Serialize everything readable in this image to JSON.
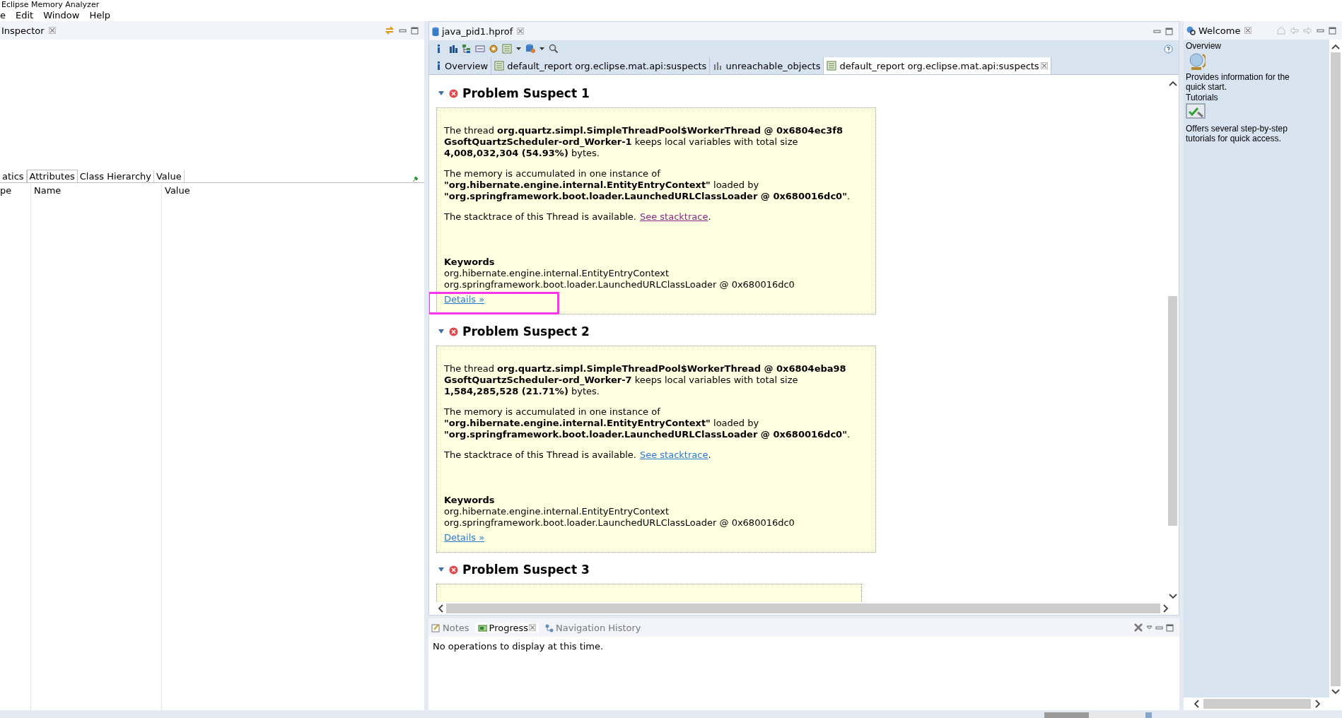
{
  "window": {
    "title": "Eclipse Memory Analyzer"
  },
  "menu": [
    {
      "label": "e"
    },
    {
      "label": "Edit"
    },
    {
      "label": "Window"
    },
    {
      "label": "Help"
    }
  ],
  "inspector": {
    "tab": "Inspector",
    "tabs": [
      {
        "label": "atics",
        "selected": false
      },
      {
        "label": "Attributes",
        "selected": true
      },
      {
        "label": "Class Hierarchy",
        "selected": false
      },
      {
        "label": "Value",
        "selected": false
      }
    ],
    "columns": [
      "pe",
      "Name",
      "Value"
    ]
  },
  "editor": {
    "tab": "java_pid1.hprof",
    "report_tabs": [
      {
        "label": "Overview",
        "kind": "info",
        "selected": false,
        "closable": false
      },
      {
        "label": "default_report  org.eclipse.mat.api:suspects",
        "kind": "report",
        "selected": false,
        "closable": false
      },
      {
        "label": "unreachable_objects",
        "kind": "chart",
        "selected": false,
        "closable": false
      },
      {
        "label": "default_report  org.eclipse.mat.api:suspects",
        "kind": "report",
        "selected": true,
        "closable": true
      }
    ],
    "suspects": [
      {
        "title": "Problem Suspect 1",
        "expanded": true,
        "paragraphs": [
          "The thread **org.quartz.simpl.SimpleThreadPool$WorkerThread @ 0x6804ec3f8 GsoftQuartzScheduler-ord_Worker-1** keeps local variables with total size **4,008,032,304 (54.93%)** bytes.",
          "The memory is accumulated in one instance of **\"org.hibernate.engine.internal.EntityEntryContext\"** loaded by **\"org.springframework.boot.loader.LaunchedURLClassLoader @ 0x680016dc0\"**."
        ],
        "stack_text": "The stacktrace of this Thread is available.",
        "stack_link": {
          "label": "See stacktrace",
          "visited": true
        },
        "stack_end": ".",
        "keywords_title": "Keywords",
        "keywords": [
          "org.hibernate.engine.internal.EntityEntryContext",
          "org.springframework.boot.loader.LaunchedURLClassLoader @ 0x680016dc0"
        ],
        "details": "Details »",
        "highlighted": true
      },
      {
        "title": "Problem Suspect 2",
        "expanded": true,
        "paragraphs": [
          "The thread **org.quartz.simpl.SimpleThreadPool$WorkerThread @ 0x6804eba98 GsoftQuartzScheduler-ord_Worker-7** keeps local variables with total size **1,584,285,528 (21.71%)** bytes.",
          "The memory is accumulated in one instance of **\"org.hibernate.engine.internal.EntityEntryContext\"** loaded by **\"org.springframework.boot.loader.LaunchedURLClassLoader @ 0x680016dc0\"**."
        ],
        "stack_text": "The stacktrace of this Thread is available.",
        "stack_link": {
          "label": "See stacktrace",
          "visited": false
        },
        "stack_end": ".",
        "keywords_title": "Keywords",
        "keywords": [
          "org.hibernate.engine.internal.EntityEntryContext",
          "org.springframework.boot.loader.LaunchedURLClassLoader @ 0x680016dc0"
        ],
        "details": "Details »",
        "highlighted": false
      },
      {
        "title": "Problem Suspect 3",
        "expanded": true
      }
    ]
  },
  "bottom": {
    "tabs": [
      {
        "label": "Notes",
        "kind": "notes",
        "selected": false
      },
      {
        "label": "Progress",
        "kind": "progress",
        "selected": true
      },
      {
        "label": "Navigation History",
        "kind": "history",
        "selected": false
      }
    ],
    "message": "No operations to display at this time."
  },
  "welcome": {
    "tab": "Welcome",
    "items": [
      {
        "title": "Overview",
        "kind": "globe",
        "description": "Provides information for the quick start."
      },
      {
        "title": "Tutorials",
        "kind": "checklist",
        "description": "Offers several step-by-step tutorials for quick access."
      }
    ]
  }
}
